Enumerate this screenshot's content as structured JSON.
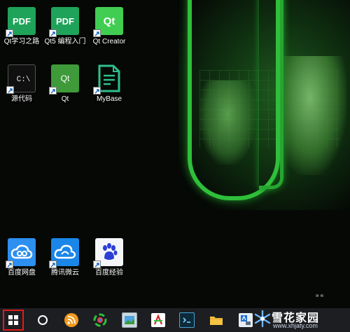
{
  "desktop": {
    "icons": [
      {
        "label": "Qt学习之路",
        "tile_text": "PDF"
      },
      {
        "label": "Qt5 编程入门",
        "tile_text": "PDF"
      },
      {
        "label": "Qt Creator",
        "tile_text": "Qt"
      },
      {
        "label": "源代码",
        "tile_text": "C:\\"
      },
      {
        "label": "Qt",
        "tile_text": "Qt"
      },
      {
        "label": "MyBase"
      },
      {
        "label": "百度网盘"
      },
      {
        "label": "腾讯微云"
      },
      {
        "label": "百度经验"
      }
    ]
  },
  "taskbar": {
    "items": [
      "windows-start",
      "search-circle",
      "rss",
      "colorful-app",
      "picture-viewer",
      "acrobat",
      "terminal",
      "file-explorer",
      "language-input"
    ]
  },
  "brand": {
    "name": "雪花家园",
    "url": "www.xhjaty.com"
  },
  "colors": {
    "taskbar": "#1c1e22",
    "start_highlight": "#e11b1b",
    "wallpaper_green": "#2fbf3a"
  }
}
